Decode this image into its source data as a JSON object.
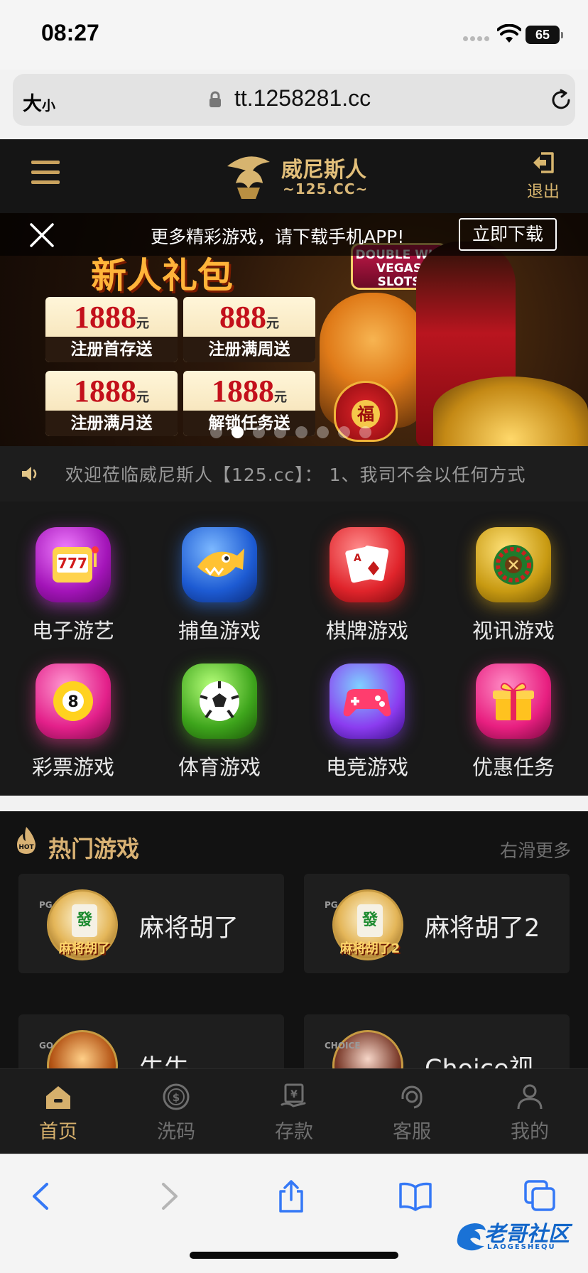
{
  "status_bar": {
    "time": "08:27",
    "battery": "65"
  },
  "browser": {
    "text_size_label": "大",
    "text_size_small": "小",
    "url": "tt.1258281.cc"
  },
  "header": {
    "logo_name": "威尼斯人",
    "logo_domain": "~125.CC~",
    "logout_label": "退出"
  },
  "download_bar": {
    "text": "更多精彩游戏，请下载手机APP!",
    "button": "立即下载"
  },
  "banner": {
    "title": "新人礼包",
    "slots_logo": "DOUBLE WIN VEGAS SLOTS",
    "bag_char": "福",
    "bonuses": [
      {
        "amount": "1888",
        "unit": "元",
        "desc": "注册首存送"
      },
      {
        "amount": "888",
        "unit": "元",
        "desc": "注册满周送"
      },
      {
        "amount": "1888",
        "unit": "元",
        "desc": "注册满月送"
      },
      {
        "amount": "1888",
        "unit": "元",
        "desc": "解锁任务送"
      }
    ],
    "slide_count": 8,
    "active_slide": 2
  },
  "notice": {
    "text": "欢迎莅临威尼斯人【125.cc】： 1、我司不会以任何方式"
  },
  "categories": [
    {
      "label": "电子游艺",
      "icon": "slot-machine-icon"
    },
    {
      "label": "捕鱼游戏",
      "icon": "fish-icon"
    },
    {
      "label": "棋牌游戏",
      "icon": "playing-cards-icon"
    },
    {
      "label": "视讯游戏",
      "icon": "roulette-icon"
    },
    {
      "label": "彩票游戏",
      "icon": "lottery-ball-icon"
    },
    {
      "label": "体育游戏",
      "icon": "soccer-ball-icon"
    },
    {
      "label": "电竞游戏",
      "icon": "gamepad-icon"
    },
    {
      "label": "优惠任务",
      "icon": "gift-icon"
    }
  ],
  "hot_games": {
    "title": "热门游戏",
    "more": "右滑更多",
    "games": [
      {
        "name": "麻将胡了",
        "thumb_tile": "發",
        "thumb_caption": "麻将胡了",
        "maker": "PG"
      },
      {
        "name": "麻将胡了2",
        "thumb_tile": "發",
        "thumb_caption": "麻将胡了2",
        "maker": "PG"
      },
      {
        "name": "牛牛",
        "thumb_tile": "",
        "thumb_caption": "",
        "maker": "GO"
      },
      {
        "name": "Choice视",
        "thumb_tile": "",
        "thumb_caption": "",
        "maker": "CHOICE"
      }
    ]
  },
  "tabs": [
    {
      "label": "首页",
      "icon": "home-icon",
      "active": true
    },
    {
      "label": "洗码",
      "icon": "coin-icon",
      "active": false
    },
    {
      "label": "存款",
      "icon": "deposit-icon",
      "active": false
    },
    {
      "label": "客服",
      "icon": "headset-icon",
      "active": false
    },
    {
      "label": "我的",
      "icon": "user-icon",
      "active": false
    }
  ],
  "watermark": {
    "text": "老哥社区",
    "sub": "LAOGESHEQU"
  },
  "colors": {
    "accent_gold": "#d6b06c",
    "page_bg": "#191919",
    "safari_blue": "#3478f6"
  }
}
